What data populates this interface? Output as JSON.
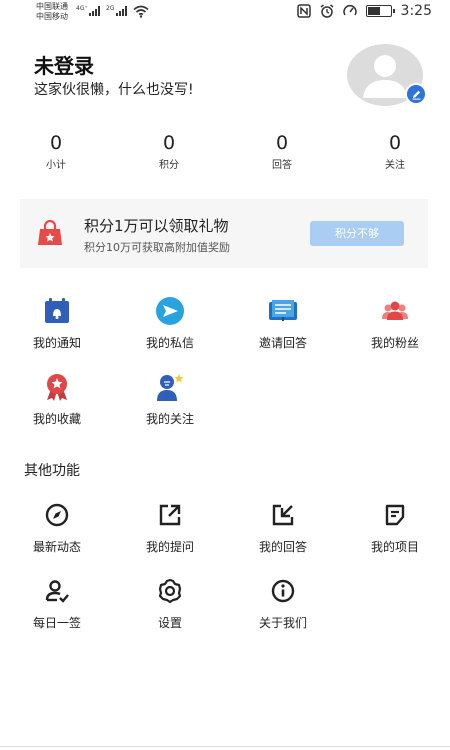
{
  "status_bar": {
    "carrier1": "中国联通",
    "carrier2": "中国移动",
    "net1": "4G⁺",
    "net2": "2G",
    "time": "3:25"
  },
  "profile": {
    "name": "未登录",
    "bio": "这家伙很懒，什么也没写!"
  },
  "stats": [
    {
      "value": "0",
      "label": "小计"
    },
    {
      "value": "0",
      "label": "积分"
    },
    {
      "value": "0",
      "label": "回答"
    },
    {
      "value": "0",
      "label": "关注"
    }
  ],
  "gift_banner": {
    "title": "积分1万可以领取礼物",
    "subtitle": "积分10万可获取高附加值奖励",
    "button": "积分不够",
    "button_color": "#a9cdf3",
    "icon": "gift-bag-icon"
  },
  "main_menu": [
    {
      "label": "我的通知",
      "icon": "notification-calendar-icon"
    },
    {
      "label": "我的私信",
      "icon": "message-send-icon"
    },
    {
      "label": "邀请回答",
      "icon": "invite-book-icon"
    },
    {
      "label": "我的粉丝",
      "icon": "fans-group-icon"
    },
    {
      "label": "我的收藏",
      "icon": "collection-ribbon-icon"
    },
    {
      "label": "我的关注",
      "icon": "follow-person-icon"
    }
  ],
  "other": {
    "title": "其他功能",
    "items": [
      {
        "label": "最新动态",
        "icon": "compass-icon"
      },
      {
        "label": "我的提问",
        "icon": "question-export-icon"
      },
      {
        "label": "我的回答",
        "icon": "answer-import-icon"
      },
      {
        "label": "我的项目",
        "icon": "note-icon"
      },
      {
        "label": "每日一签",
        "icon": "user-check-icon"
      },
      {
        "label": "设置",
        "icon": "settings-gear-icon"
      },
      {
        "label": "关于我们",
        "icon": "info-icon"
      }
    ]
  },
  "colors": {
    "accent": "#2f72d9",
    "gift_red": "#e84a4a"
  }
}
